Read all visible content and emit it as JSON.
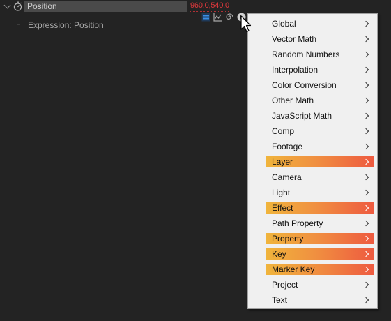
{
  "property": {
    "name": "Position",
    "value": "960.0,540.0",
    "value_color": "#e0383c"
  },
  "expression": {
    "label": "Expression: Position"
  },
  "toolbar": {
    "icons": [
      "expression-enable-icon",
      "graph-icon",
      "pickwhip-icon",
      "expression-language-menu-icon"
    ]
  },
  "menu": {
    "highlight_gradient": [
      "#f0b43c",
      "#ee5a40"
    ],
    "items": [
      {
        "label": "Global",
        "highlighted": false
      },
      {
        "label": "Vector Math",
        "highlighted": false
      },
      {
        "label": "Random Numbers",
        "highlighted": false
      },
      {
        "label": "Interpolation",
        "highlighted": false
      },
      {
        "label": "Color Conversion",
        "highlighted": false
      },
      {
        "label": "Other Math",
        "highlighted": false
      },
      {
        "label": "JavaScript Math",
        "highlighted": false
      },
      {
        "label": "Comp",
        "highlighted": false
      },
      {
        "label": "Footage",
        "highlighted": false
      },
      {
        "label": "Layer",
        "highlighted": true
      },
      {
        "label": "Camera",
        "highlighted": false
      },
      {
        "label": "Light",
        "highlighted": false
      },
      {
        "label": "Effect",
        "highlighted": true
      },
      {
        "label": "Path Property",
        "highlighted": false
      },
      {
        "label": "Property",
        "highlighted": true
      },
      {
        "label": "Key",
        "highlighted": true
      },
      {
        "label": "Marker Key",
        "highlighted": true
      },
      {
        "label": "Project",
        "highlighted": false
      },
      {
        "label": "Text",
        "highlighted": false
      }
    ]
  }
}
